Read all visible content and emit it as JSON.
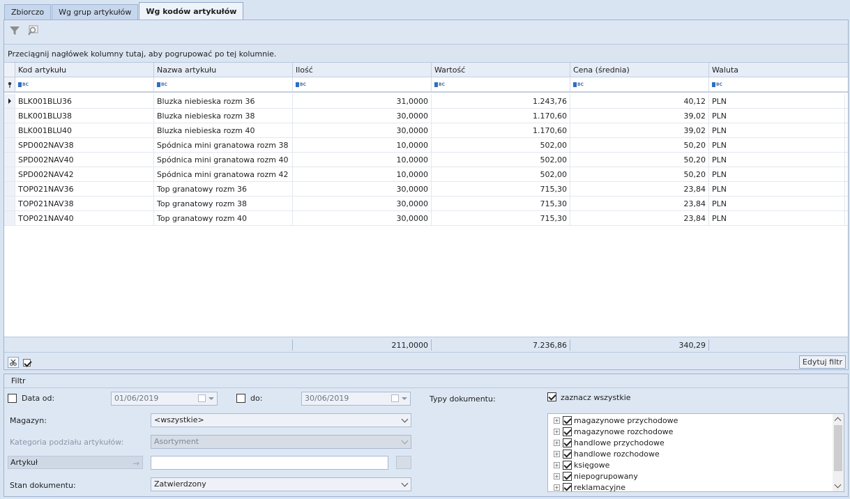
{
  "tabs": [
    {
      "label": "Zbiorczo"
    },
    {
      "label": "Wg grup artykułów"
    },
    {
      "label": "Wg kodów artykułów",
      "active": true
    }
  ],
  "toolbar": {
    "filter_icon": "funnel-icon",
    "search_icon": "magnifier-icon"
  },
  "group_hint": "Przeciągnij nagłówek kolumny tutaj, aby pogrupować po tej kolumnie.",
  "grid": {
    "columns": [
      "Kod artykułu",
      "Nazwa artykułu",
      "Ilość",
      "Wartość",
      "Cena (średnia)",
      "Waluta"
    ],
    "rows": [
      [
        "BLK001BLU36",
        "Bluzka niebieska rozm 36",
        "31,0000",
        "1.243,76",
        "40,12",
        "PLN"
      ],
      [
        "BLK001BLU38",
        "Bluzka niebieska rozm 38",
        "30,0000",
        "1.170,60",
        "39,02",
        "PLN"
      ],
      [
        "BLK001BLU40",
        "Bluzka niebieska rozm 40",
        "30,0000",
        "1.170,60",
        "39,02",
        "PLN"
      ],
      [
        "SPD002NAV38",
        "Spódnica mini granatowa rozm 38",
        "10,0000",
        "502,00",
        "50,20",
        "PLN"
      ],
      [
        "SPD002NAV40",
        "Spódnica mini granatowa rozm 40",
        "10,0000",
        "502,00",
        "50,20",
        "PLN"
      ],
      [
        "SPD002NAV42",
        "Spódnica mini granatowa rozm 42",
        "10,0000",
        "502,00",
        "50,20",
        "PLN"
      ],
      [
        "TOP021NAV36",
        "Top granatowy rozm 36",
        "30,0000",
        "715,30",
        "23,84",
        "PLN"
      ],
      [
        "TOP021NAV38",
        "Top granatowy rozm 38",
        "30,0000",
        "715,30",
        "23,84",
        "PLN"
      ],
      [
        "TOP021NAV40",
        "Top granatowy rozm 40",
        "30,0000",
        "715,30",
        "23,84",
        "PLN"
      ]
    ],
    "totals": {
      "ilosc": "211,0000",
      "wartosc": "7.236,86",
      "cena": "340,29"
    }
  },
  "bottom": {
    "edit_filter": "Edytuj filtr"
  },
  "filter": {
    "title": "Filtr",
    "date_from_label": "Data od:",
    "date_from_value": "01/06/2019",
    "date_to_label": "do:",
    "date_to_value": "30/06/2019",
    "magazyn_label": "Magazyn:",
    "magazyn_value": "<wszystkie>",
    "kategoria_label": "Kategoria podziału artykułów:",
    "kategoria_value": "Asortyment",
    "artykul_label": "Artykuł",
    "stan_label": "Stan dokumentu:",
    "stan_value": "Zatwierdzony",
    "typy_label": "Typy dokumentu:",
    "select_all_label": "zaznacz wszystkie",
    "doc_types": [
      "magazynowe przychodowe",
      "magazynowe rozchodowe",
      "handlowe przychodowe",
      "handlowe rozchodowe",
      "księgowe",
      "niepogrupowany",
      "reklamacyjne"
    ]
  }
}
